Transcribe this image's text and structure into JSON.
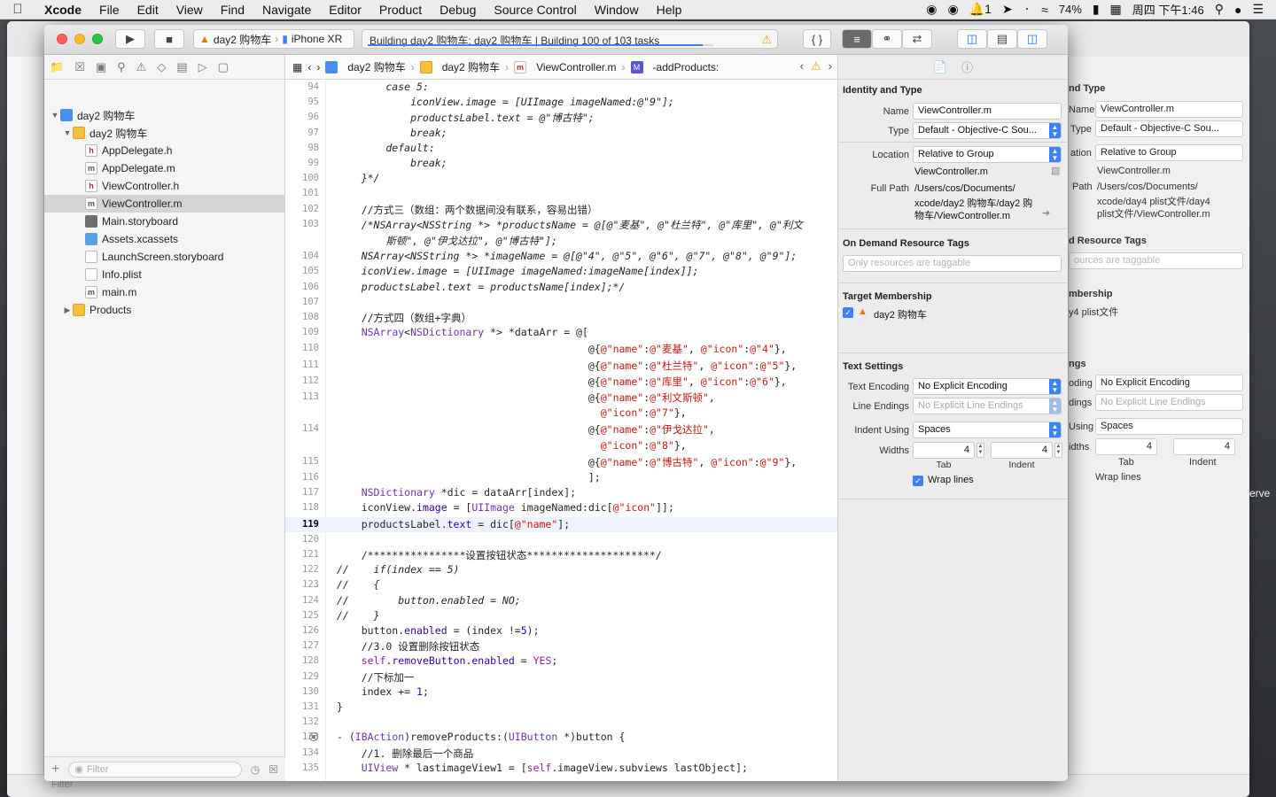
{
  "menubar": {
    "app": "Xcode",
    "items": [
      "File",
      "Edit",
      "View",
      "Find",
      "Navigate",
      "Editor",
      "Product",
      "Debug",
      "Source Control",
      "Window",
      "Help"
    ],
    "battery": "74%",
    "clock": "周四 下午1:46",
    "notif_count": "1"
  },
  "toolbar": {
    "scheme": "day2 购物车",
    "device": "iPhone XR",
    "activity": "Building day2 购物车: day2 购物车 | Building 100 of 103 tasks",
    "progress_fraction": 0.97
  },
  "navigator": {
    "items": [
      {
        "label": "day2 购物车",
        "kind": "proj",
        "indent": 0,
        "open": true
      },
      {
        "label": "day2 购物车",
        "kind": "folder",
        "indent": 1,
        "open": true
      },
      {
        "label": "AppDelegate.h",
        "kind": "h",
        "indent": 2
      },
      {
        "label": "AppDelegate.m",
        "kind": "m",
        "indent": 2
      },
      {
        "label": "ViewController.h",
        "kind": "h",
        "indent": 2
      },
      {
        "label": "ViewController.m",
        "kind": "m",
        "indent": 2,
        "selected": true
      },
      {
        "label": "Main.storyboard",
        "kind": "sb",
        "indent": 2
      },
      {
        "label": "Assets.xcassets",
        "kind": "xc",
        "indent": 2
      },
      {
        "label": "LaunchScreen.storyboard",
        "kind": "sb2",
        "indent": 2
      },
      {
        "label": "Info.plist",
        "kind": "plist",
        "indent": 2
      },
      {
        "label": "main.m",
        "kind": "m",
        "indent": 2
      },
      {
        "label": "Products",
        "kind": "folder",
        "indent": 1,
        "open": false
      }
    ],
    "filter_placeholder": "Filter"
  },
  "jumpbar": {
    "crumbs": [
      "day2 购物车",
      "day2 购物车",
      "ViewController.m",
      "-addProducts:"
    ]
  },
  "code": {
    "current_line": 119,
    "lines": [
      {
        "n": "94",
        "t": "        case 5:",
        "c": "ital"
      },
      {
        "n": "95",
        "t": "            iconView.image = [UIImage imageNamed:@\"9\"];",
        "c": "ital"
      },
      {
        "n": "96",
        "t": "            productsLabel.text = @\"博古特\";",
        "c": "ital"
      },
      {
        "n": "97",
        "t": "            break;",
        "c": "ital"
      },
      {
        "n": "98",
        "t": "        default:",
        "c": "ital"
      },
      {
        "n": "99",
        "t": "            break;",
        "c": "ital"
      },
      {
        "n": "100",
        "t": "    }*/",
        "c": "ital"
      },
      {
        "n": "101",
        "t": "",
        "c": ""
      },
      {
        "n": "102",
        "t": "    //方式三（数组：两个数据间没有联系，容易出错）",
        "c": "cm"
      },
      {
        "n": "103",
        "t": "    /*NSArray<NSString *> *productsName = @[@\"麦基\", @\"杜兰特\", @\"库里\", @\"利文",
        "c": "ital"
      },
      {
        "n": "",
        "t": "        斯顿\", @\"伊戈达拉\", @\"博古特\"];",
        "c": "ital"
      },
      {
        "n": "104",
        "t": "    NSArray<NSString *> *imageName = @[@\"4\", @\"5\", @\"6\", @\"7\", @\"8\", @\"9\"];",
        "c": "ital"
      },
      {
        "n": "105",
        "t": "    iconView.image = [UIImage imageNamed:imageName[index]];",
        "c": "ital"
      },
      {
        "n": "106",
        "t": "    productsLabel.text = productsName[index];*/",
        "c": "ital"
      },
      {
        "n": "107",
        "t": "",
        "c": ""
      },
      {
        "n": "108",
        "t": "    //方式四（数组+字典）",
        "c": "cm"
      },
      {
        "n": "109",
        "t": "    NSArray<NSDictionary *> *dataArr = @[",
        "c": "code"
      },
      {
        "n": "110",
        "t": "                                         @{@\"name\":@\"麦基\", @\"icon\":@\"4\"},",
        "c": "code"
      },
      {
        "n": "111",
        "t": "                                         @{@\"name\":@\"杜兰特\", @\"icon\":@\"5\"},",
        "c": "code"
      },
      {
        "n": "112",
        "t": "                                         @{@\"name\":@\"库里\", @\"icon\":@\"6\"},",
        "c": "code"
      },
      {
        "n": "113",
        "t": "                                         @{@\"name\":@\"利文斯顿\",",
        "c": "code"
      },
      {
        "n": "",
        "t": "                                           @\"icon\":@\"7\"},",
        "c": "code"
      },
      {
        "n": "114",
        "t": "                                         @{@\"name\":@\"伊戈达拉\",",
        "c": "code"
      },
      {
        "n": "",
        "t": "                                           @\"icon\":@\"8\"},",
        "c": "code"
      },
      {
        "n": "115",
        "t": "                                         @{@\"name\":@\"博古特\", @\"icon\":@\"9\"},",
        "c": "code"
      },
      {
        "n": "116",
        "t": "                                         ];",
        "c": "code"
      },
      {
        "n": "117",
        "t": "    NSDictionary *dic = dataArr[index];",
        "c": "code"
      },
      {
        "n": "118",
        "t": "    iconView.image = [UIImage imageNamed:dic[@\"icon\"]];",
        "c": "code"
      },
      {
        "n": "119",
        "t": "    productsLabel.text = dic[@\"name\"];",
        "c": "code"
      },
      {
        "n": "120",
        "t": "",
        "c": ""
      },
      {
        "n": "121",
        "t": "    /****************设置按钮状态*********************/",
        "c": "cm"
      },
      {
        "n": "122",
        "t": "//    if(index == 5)",
        "c": "cmi"
      },
      {
        "n": "123",
        "t": "//    {",
        "c": "cmi"
      },
      {
        "n": "124",
        "t": "//        button.enabled = NO;",
        "c": "cmi"
      },
      {
        "n": "125",
        "t": "//    }",
        "c": "cmi"
      },
      {
        "n": "126",
        "t": "    button.enabled = (index !=5);",
        "c": "code"
      },
      {
        "n": "127",
        "t": "    //3.0 设置删除按钮状态",
        "c": "cm"
      },
      {
        "n": "128",
        "t": "    self.removeButton.enabled = YES;",
        "c": "code"
      },
      {
        "n": "129",
        "t": "    //下标加一",
        "c": "cm"
      },
      {
        "n": "130",
        "t": "    index += 1;",
        "c": "code"
      },
      {
        "n": "131",
        "t": "}",
        "c": "code"
      },
      {
        "n": "132",
        "t": "",
        "c": ""
      },
      {
        "n": "133",
        "t": "- (IBAction)removeProducts:(UIButton *)button {",
        "c": "code",
        "bp": true
      },
      {
        "n": "134",
        "t": "    //1. 删除最后一个商品",
        "c": "cm"
      },
      {
        "n": "135",
        "t": "    UIView * lastimageView1 = [self.imageView.subviews lastObject];",
        "c": "code"
      }
    ]
  },
  "inspector": {
    "identity_title": "Identity and Type",
    "name_label": "Name",
    "name_value": "ViewController.m",
    "type_label": "Type",
    "type_value": "Default - Objective-C Sou...",
    "location_label": "Location",
    "location_value": "Relative to Group",
    "location_file": "ViewController.m",
    "fullpath_label": "Full Path",
    "fullpath_1": "/Users/cos/Documents/",
    "fullpath_2": "xcode/day2 购物车/day2 购",
    "fullpath_3": "物车/ViewController.m",
    "ondemand_title": "On Demand Resource Tags",
    "ondemand_placeholder": "Only resources are taggable",
    "target_title": "Target Membership",
    "target_name": "day2 购物车",
    "text_title": "Text Settings",
    "encoding_label": "Text Encoding",
    "encoding_value": "No Explicit Encoding",
    "endings_label": "Line Endings",
    "endings_value": "No Explicit Line Endings",
    "indent_label": "Indent Using",
    "indent_value": "Spaces",
    "widths_label": "Widths",
    "tab_value": "4",
    "indent_value_num": "4",
    "tab_label": "Tab",
    "indent_label_small": "Indent",
    "wrap_label": "Wrap lines"
  },
  "bg_inspector": {
    "sec1": "nd Type",
    "name_lbl": "Name",
    "name_val": "ViewController.m",
    "type_lbl": "Type",
    "type_val": "Default - Objective-C Sou...",
    "loc_lbl": "ation",
    "loc_val": "Relative to Group",
    "loc_file": "ViewController.m",
    "path_lbl": "Path",
    "path1": "/Users/cos/Documents/",
    "path2": "xcode/day4 plist文件/day4",
    "path3": "plist文件/ViewController.m",
    "sec2": "d Resource Tags",
    "ph": "ources are taggable",
    "sec3": "mbership",
    "target": "y4 plist文件",
    "sec4": "ngs",
    "enc_lbl": "oding",
    "enc_val": "No Explicit Encoding",
    "end_lbl": "dings",
    "end_val": "No Explicit Line Endings",
    "ind_lbl": "Using",
    "ind_val": "Spaces",
    "w_lbl": "idths",
    "tab": "4",
    "ind": "4",
    "tab_lbl": "Tab",
    "ind_lbl2": "Indent",
    "wrap": "Wrap lines",
    "side_text": "erve",
    "filter": "Filter"
  }
}
